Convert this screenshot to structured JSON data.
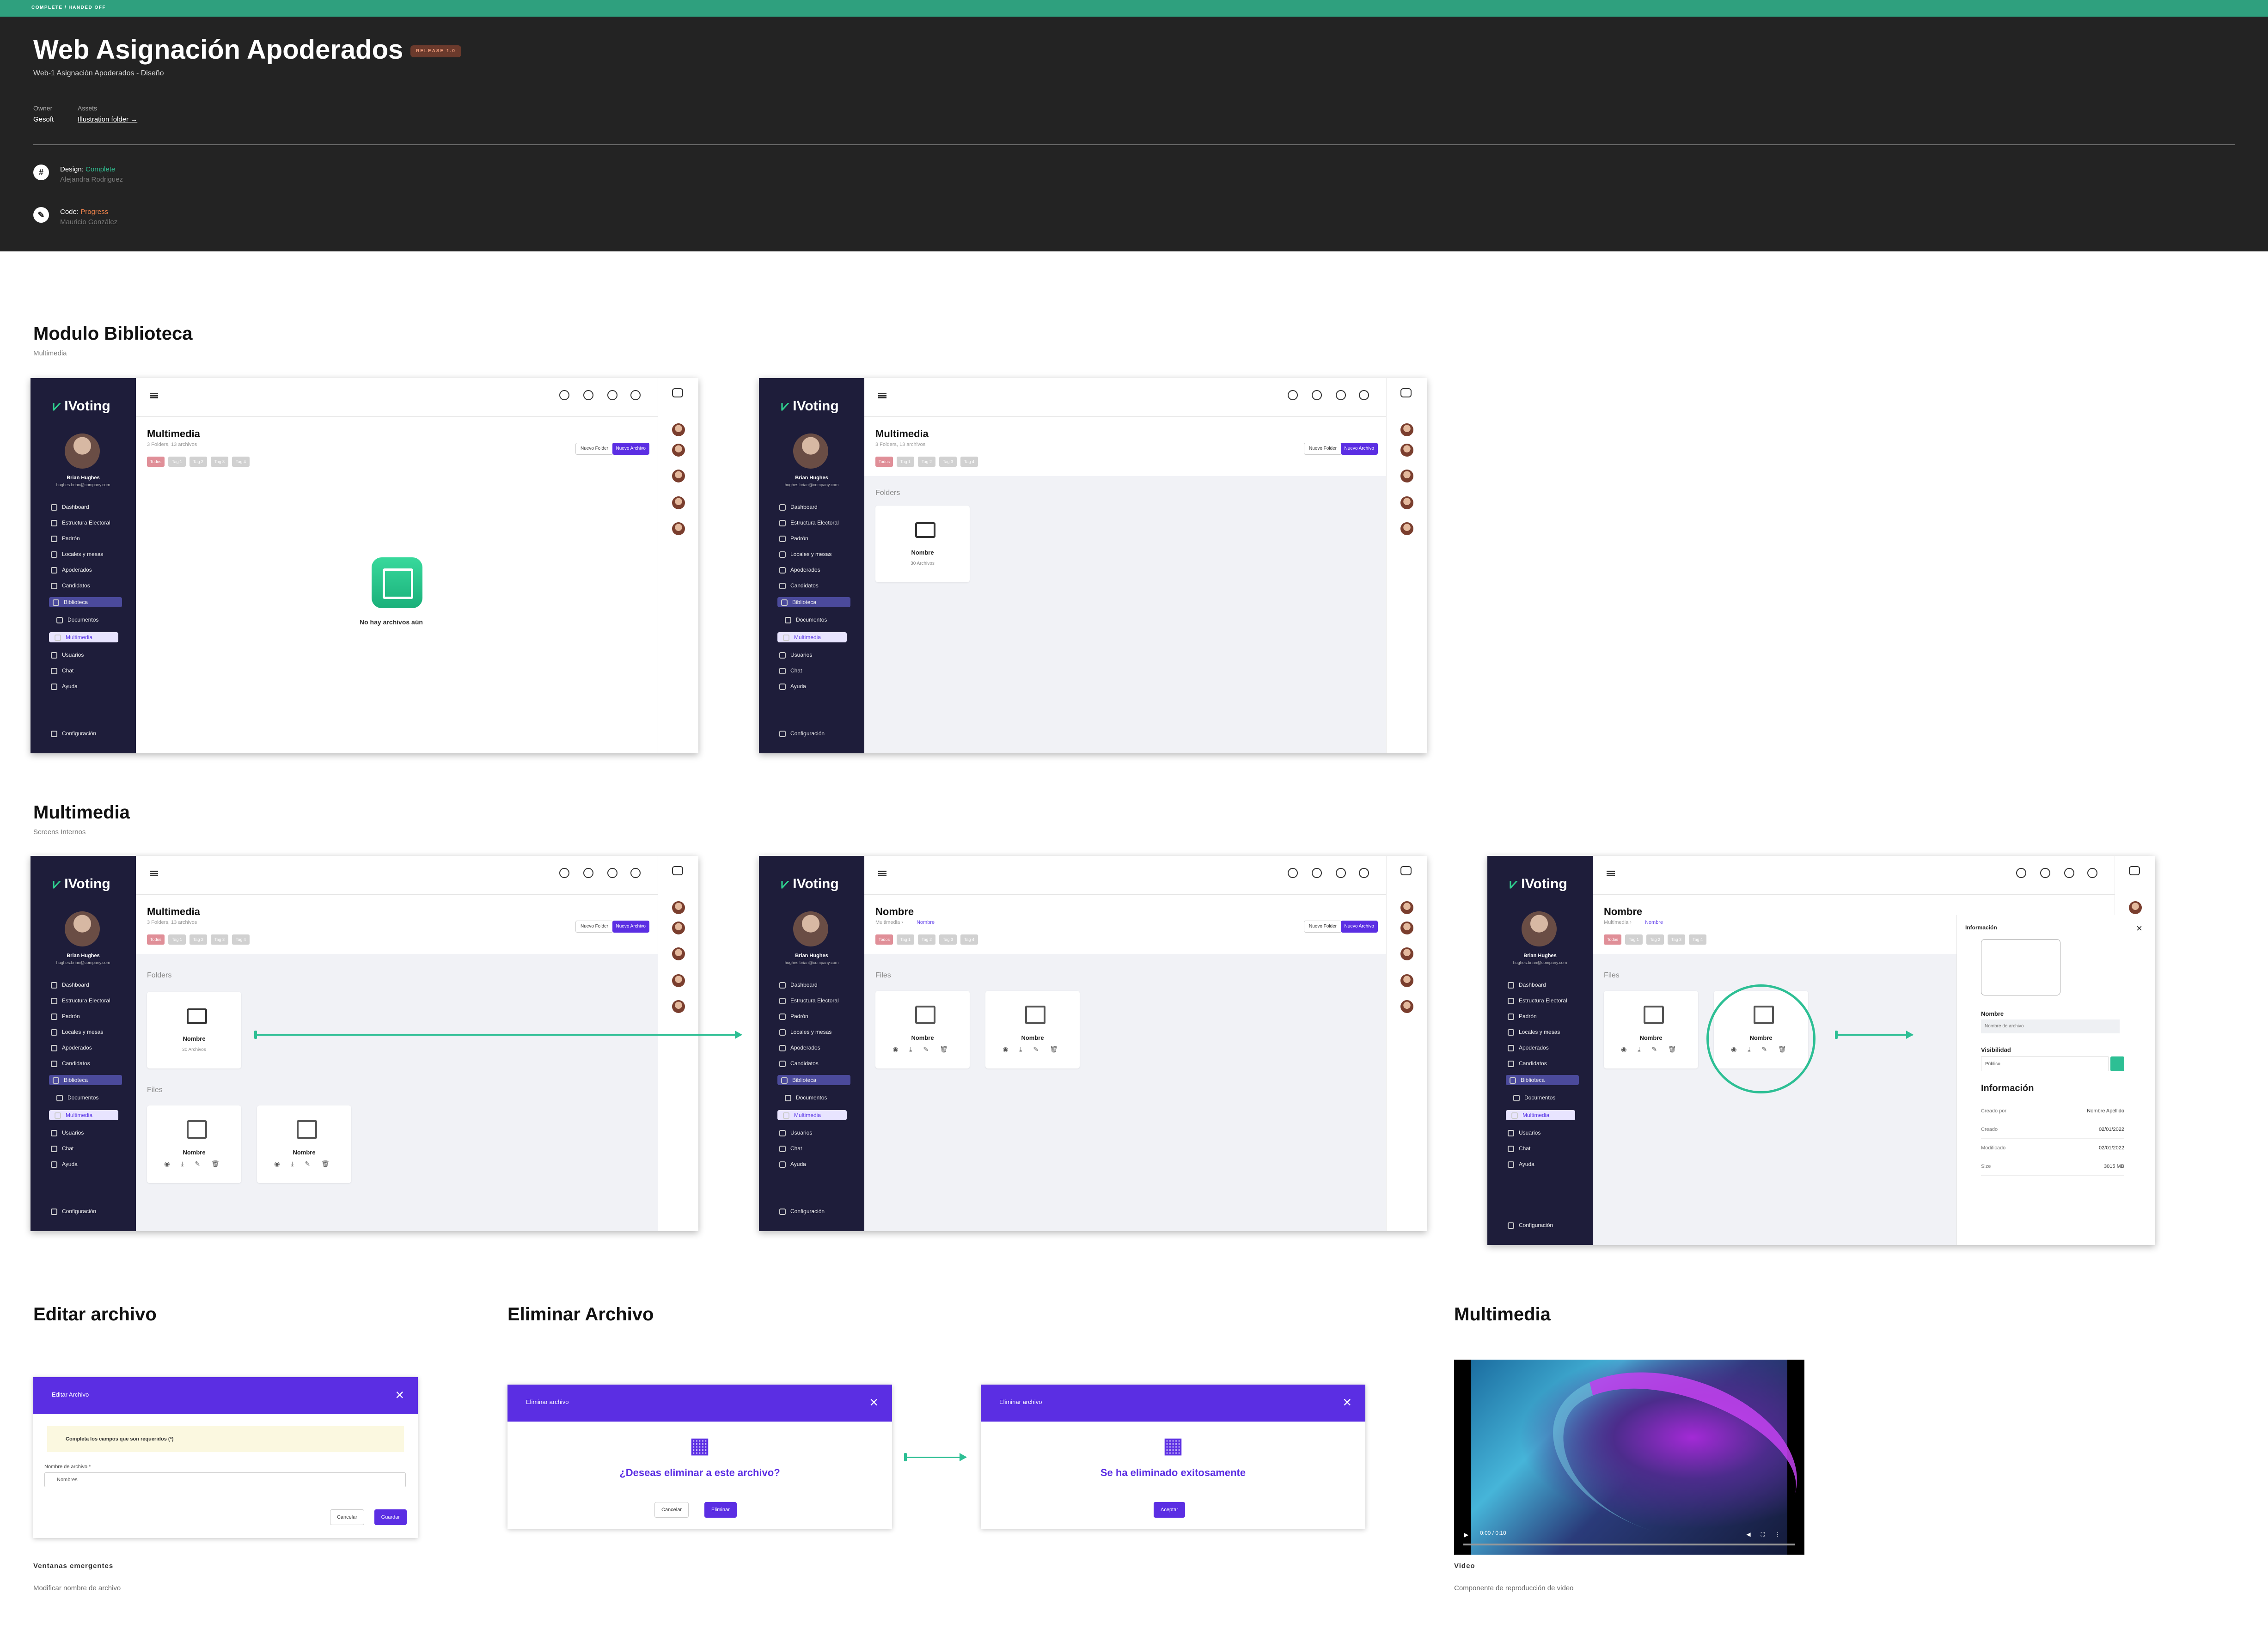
{
  "status_strip": "COMPLETE / HANDED OFF",
  "hero": {
    "title": "Web Asignación Apoderados",
    "release": "RELEASE 1.0",
    "subtitle": "Web-1 Asignación Apoderados - Diseño",
    "owner_label": "Owner",
    "owner": "Gesoft",
    "assets_label": "Assets",
    "assets_link": "Illustration folder →",
    "design_prefix": "Design: ",
    "design_status": "Complete",
    "design_person": "Alejandra Rodriguez",
    "code_prefix": "Code: ",
    "code_status": "Progress",
    "code_person": "Mauricio González",
    "design_icon": "#",
    "code_icon": "✎"
  },
  "sections": {
    "biblioteca": {
      "title": "Modulo Biblioteca",
      "sub": "Multimedia"
    },
    "multimedia": {
      "title": "Multimedia",
      "sub": "Screens Internos"
    },
    "editar": {
      "title": "Editar archivo"
    },
    "eliminar": {
      "title": "Eliminar Archivo"
    },
    "video": {
      "title": "Multimedia"
    }
  },
  "app": {
    "logo": "IVoting",
    "user_name": "Brian Hughes",
    "user_email": "hughes.brian@company.com",
    "nav": [
      "Dashboard",
      "Estructura Electoral",
      "Padrón",
      "Locales y mesas",
      "Apoderados",
      "Candidatos",
      "Biblioteca",
      "Documentos",
      "Multimedia",
      "Usuarios",
      "Chat",
      "Ayuda"
    ],
    "config": "Configuración",
    "new_folder": "Nuevo Folder",
    "new_file": "Nuevo Archivo",
    "chips": [
      "Todos",
      "Tag 1",
      "Tag 2",
      "Tag 3",
      "Tag 4"
    ]
  },
  "screens": {
    "page_title": "Multimedia",
    "page_sub": "3 Folders, 13 archivos",
    "empty_text": "No hay archivos aún",
    "folders_label": "Folders",
    "files_label": "Files",
    "card_name": "Nombre",
    "card_count": "30 Archivos",
    "detail_title": "Nombre",
    "crumb_root": "Multimedia",
    "crumb_current": "Nombre"
  },
  "info_panel": {
    "header": "Información",
    "name_label": "Nombre",
    "name_placeholder": "Nombre de archivo",
    "visibility_label": "Visibilidad",
    "visibility_value": "Público",
    "section_title": "Información",
    "rows": [
      {
        "k": "Creado por",
        "v": "Nombre Apellido"
      },
      {
        "k": "Creado",
        "v": "02/01/2022"
      },
      {
        "k": "Modificado",
        "v": "02/01/2022"
      },
      {
        "k": "Size",
        "v": "3015 MB"
      }
    ]
  },
  "edit_modal": {
    "title": "Editar Archivo",
    "warning": "Completa los campos que son requeridos (*)",
    "field_label": "Nombre de archivo *",
    "field_placeholder": "Nombres",
    "cancel": "Cancelar",
    "save": "Guardar",
    "caption": "Ventanas emergentes",
    "caption_sub": "Modificar nombre de archivo"
  },
  "delete_modal": {
    "title": "Eliminar archivo",
    "question": "¿Deseas eliminar a este archivo?",
    "cancel": "Cancelar",
    "confirm": "Eliminar",
    "success": "Se ha eliminado exitosamente",
    "accept": "Aceptar"
  },
  "video": {
    "time": "0:00 / 0:10",
    "caption": "Video",
    "caption_sub": "Componente de reproducción de video"
  },
  "colors": {
    "accent": "#5b2ee3",
    "green": "#2dbf94",
    "sidebar": "#1e1d3a"
  }
}
